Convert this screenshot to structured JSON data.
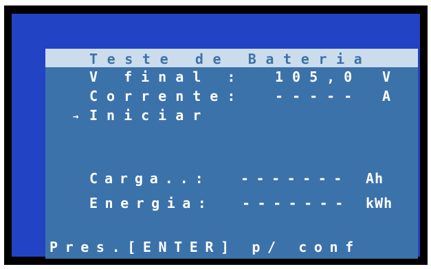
{
  "screen": {
    "title": "Teste de Bateria",
    "lines": [
      {
        "label": "V final :",
        "value": "105,0",
        "unit": "V"
      },
      {
        "label": "Corrente:",
        "value": "-----",
        "unit": "A"
      }
    ],
    "menu": {
      "cursor": "→",
      "selected_item": "Iniciar"
    },
    "readouts": [
      {
        "label": "Carga..:",
        "value": "-------",
        "unit": "Ah"
      },
      {
        "label": "Energia:",
        "value": "-------",
        "unit": "kWh"
      }
    ],
    "footer": "Pres.[ENTER] p/ conf"
  },
  "colors": {
    "lcd_background": "#3c72aa",
    "title_highlight": "#cbdcec",
    "bezel_blue": "#2243c4",
    "text": "#ffffff"
  }
}
